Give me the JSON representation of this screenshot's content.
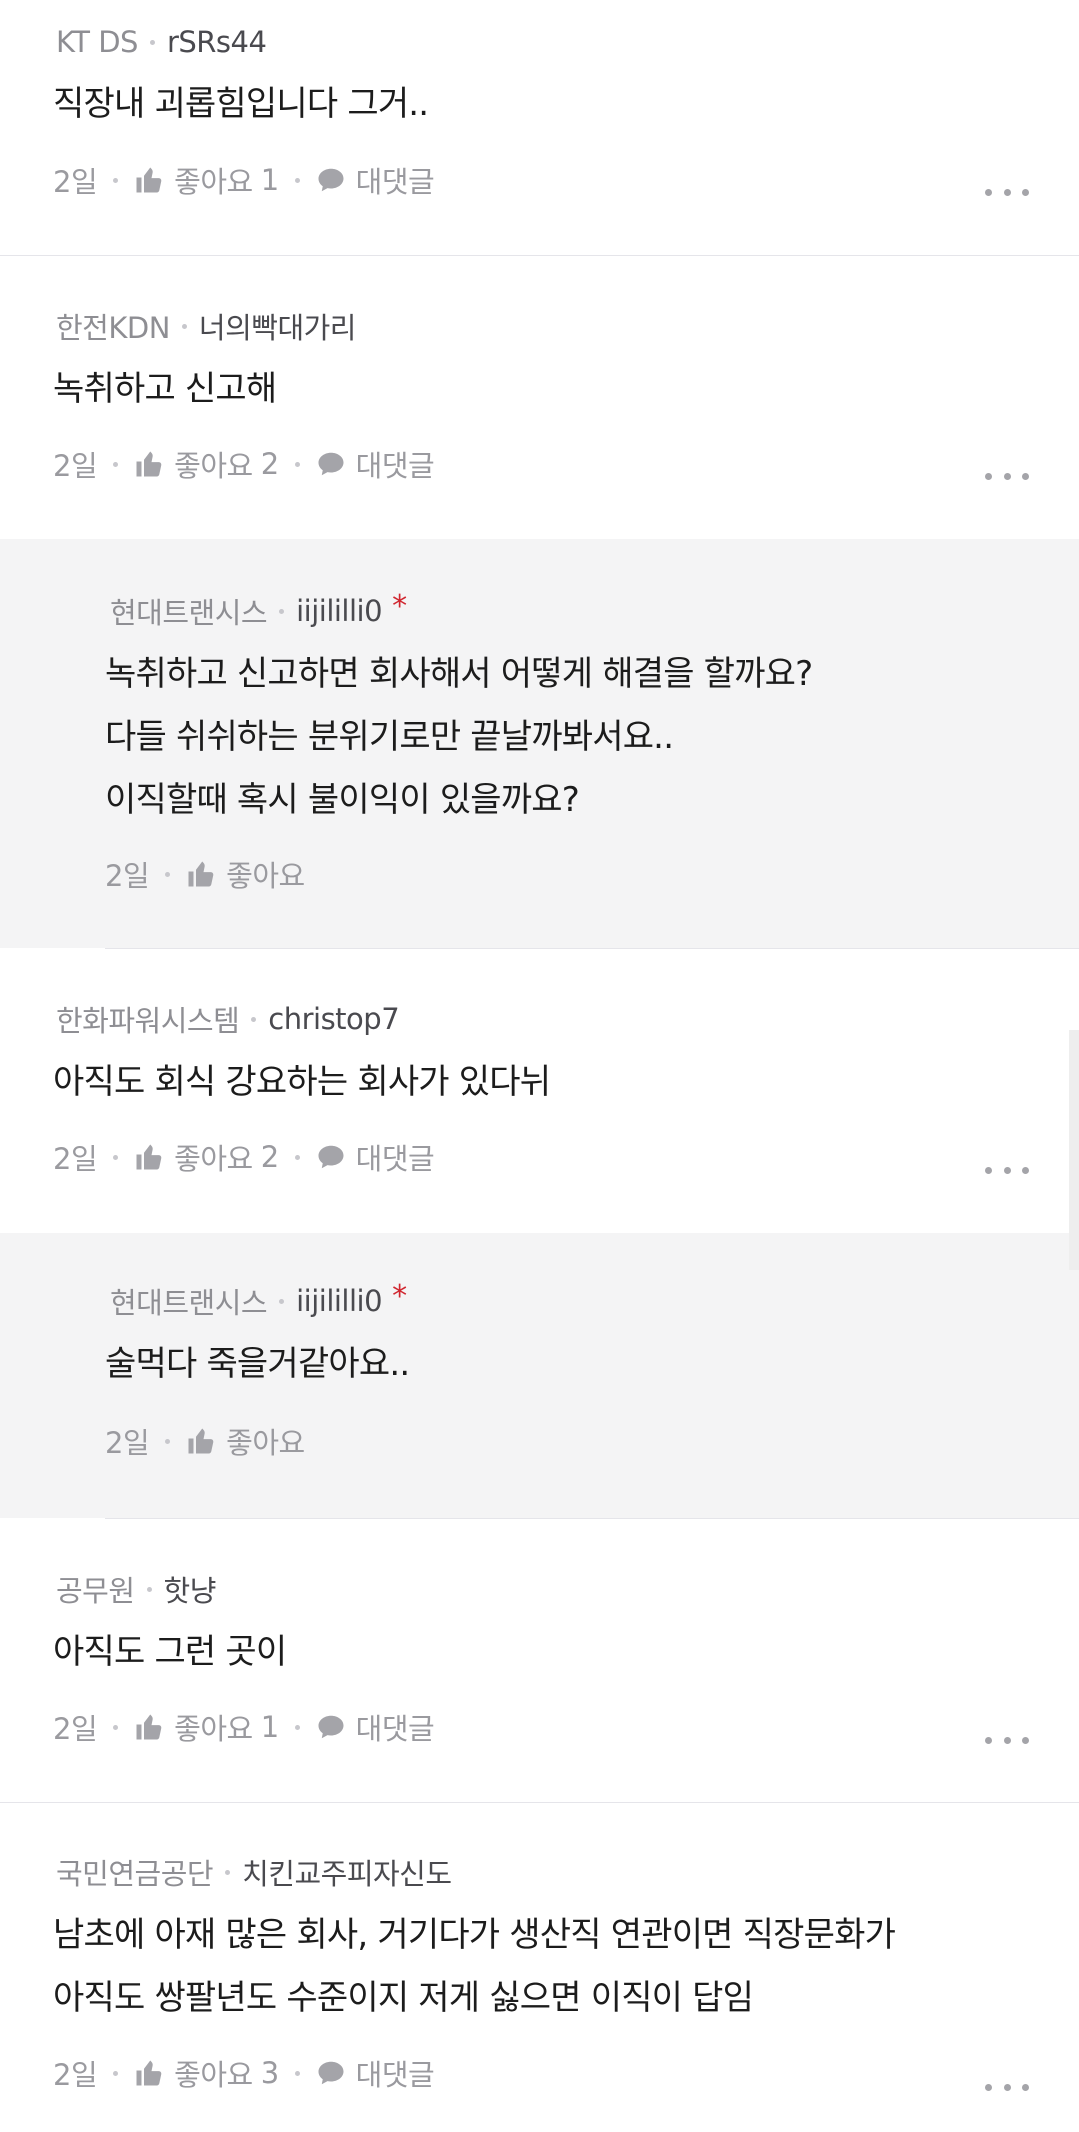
{
  "comments": [
    {
      "company": "KT DS",
      "nickname": "rSRs44",
      "lines": [
        "직장내 괴롭힘입니다 그거.."
      ],
      "time": "2일",
      "like_label": "좋아요",
      "like_count": "1",
      "reply_label": "대댓글"
    },
    {
      "company": "한전KDN",
      "nickname": "너의빡대가리",
      "lines": [
        "녹취하고 신고해"
      ],
      "time": "2일",
      "like_label": "좋아요",
      "like_count": "2",
      "reply_label": "대댓글"
    },
    {
      "company": "현대트랜시스",
      "nickname": "iijililli0",
      "author_mark": "*",
      "lines": [
        "녹취하고 신고하면 회사해서 어떻게 해결을 할까요?",
        "다들 쉬쉬하는 분위기로만 끝날까봐서요..",
        "이직할때 혹시 불이익이 있을까요?"
      ],
      "time": "2일",
      "like_label": "좋아요"
    },
    {
      "company": "한화파워시스템",
      "nickname": "christop7",
      "lines": [
        "아직도 회식 강요하는 회사가 있다뉘"
      ],
      "time": "2일",
      "like_label": "좋아요",
      "like_count": "2",
      "reply_label": "대댓글"
    },
    {
      "company": "현대트랜시스",
      "nickname": "iijililli0",
      "author_mark": "*",
      "lines": [
        "술먹다 죽을거같아요.."
      ],
      "time": "2일",
      "like_label": "좋아요"
    },
    {
      "company": "공무원",
      "nickname": "핫냥",
      "lines": [
        "아직도 그런 곳이"
      ],
      "time": "2일",
      "like_label": "좋아요",
      "like_count": "1",
      "reply_label": "대댓글"
    },
    {
      "company": "국민연금공단",
      "nickname": "치킨교주피자신도",
      "lines": [
        "남초에 아재 많은 회사, 거기다가 생산직 연관이면 직장문화가",
        "아직도 쌍팔년도 수준이지 저게 싫으면 이직이 답임"
      ],
      "time": "2일",
      "like_label": "좋아요",
      "like_count": "3",
      "reply_label": "대댓글"
    }
  ],
  "icons": {
    "like": "thumbs-up-icon",
    "reply": "speech-bubble-icon",
    "more": "more-options-icon"
  },
  "colors": {
    "reply_background": "#f4f4f5",
    "author_mark": "#d0262f",
    "meta_text": "#8e8e93"
  }
}
